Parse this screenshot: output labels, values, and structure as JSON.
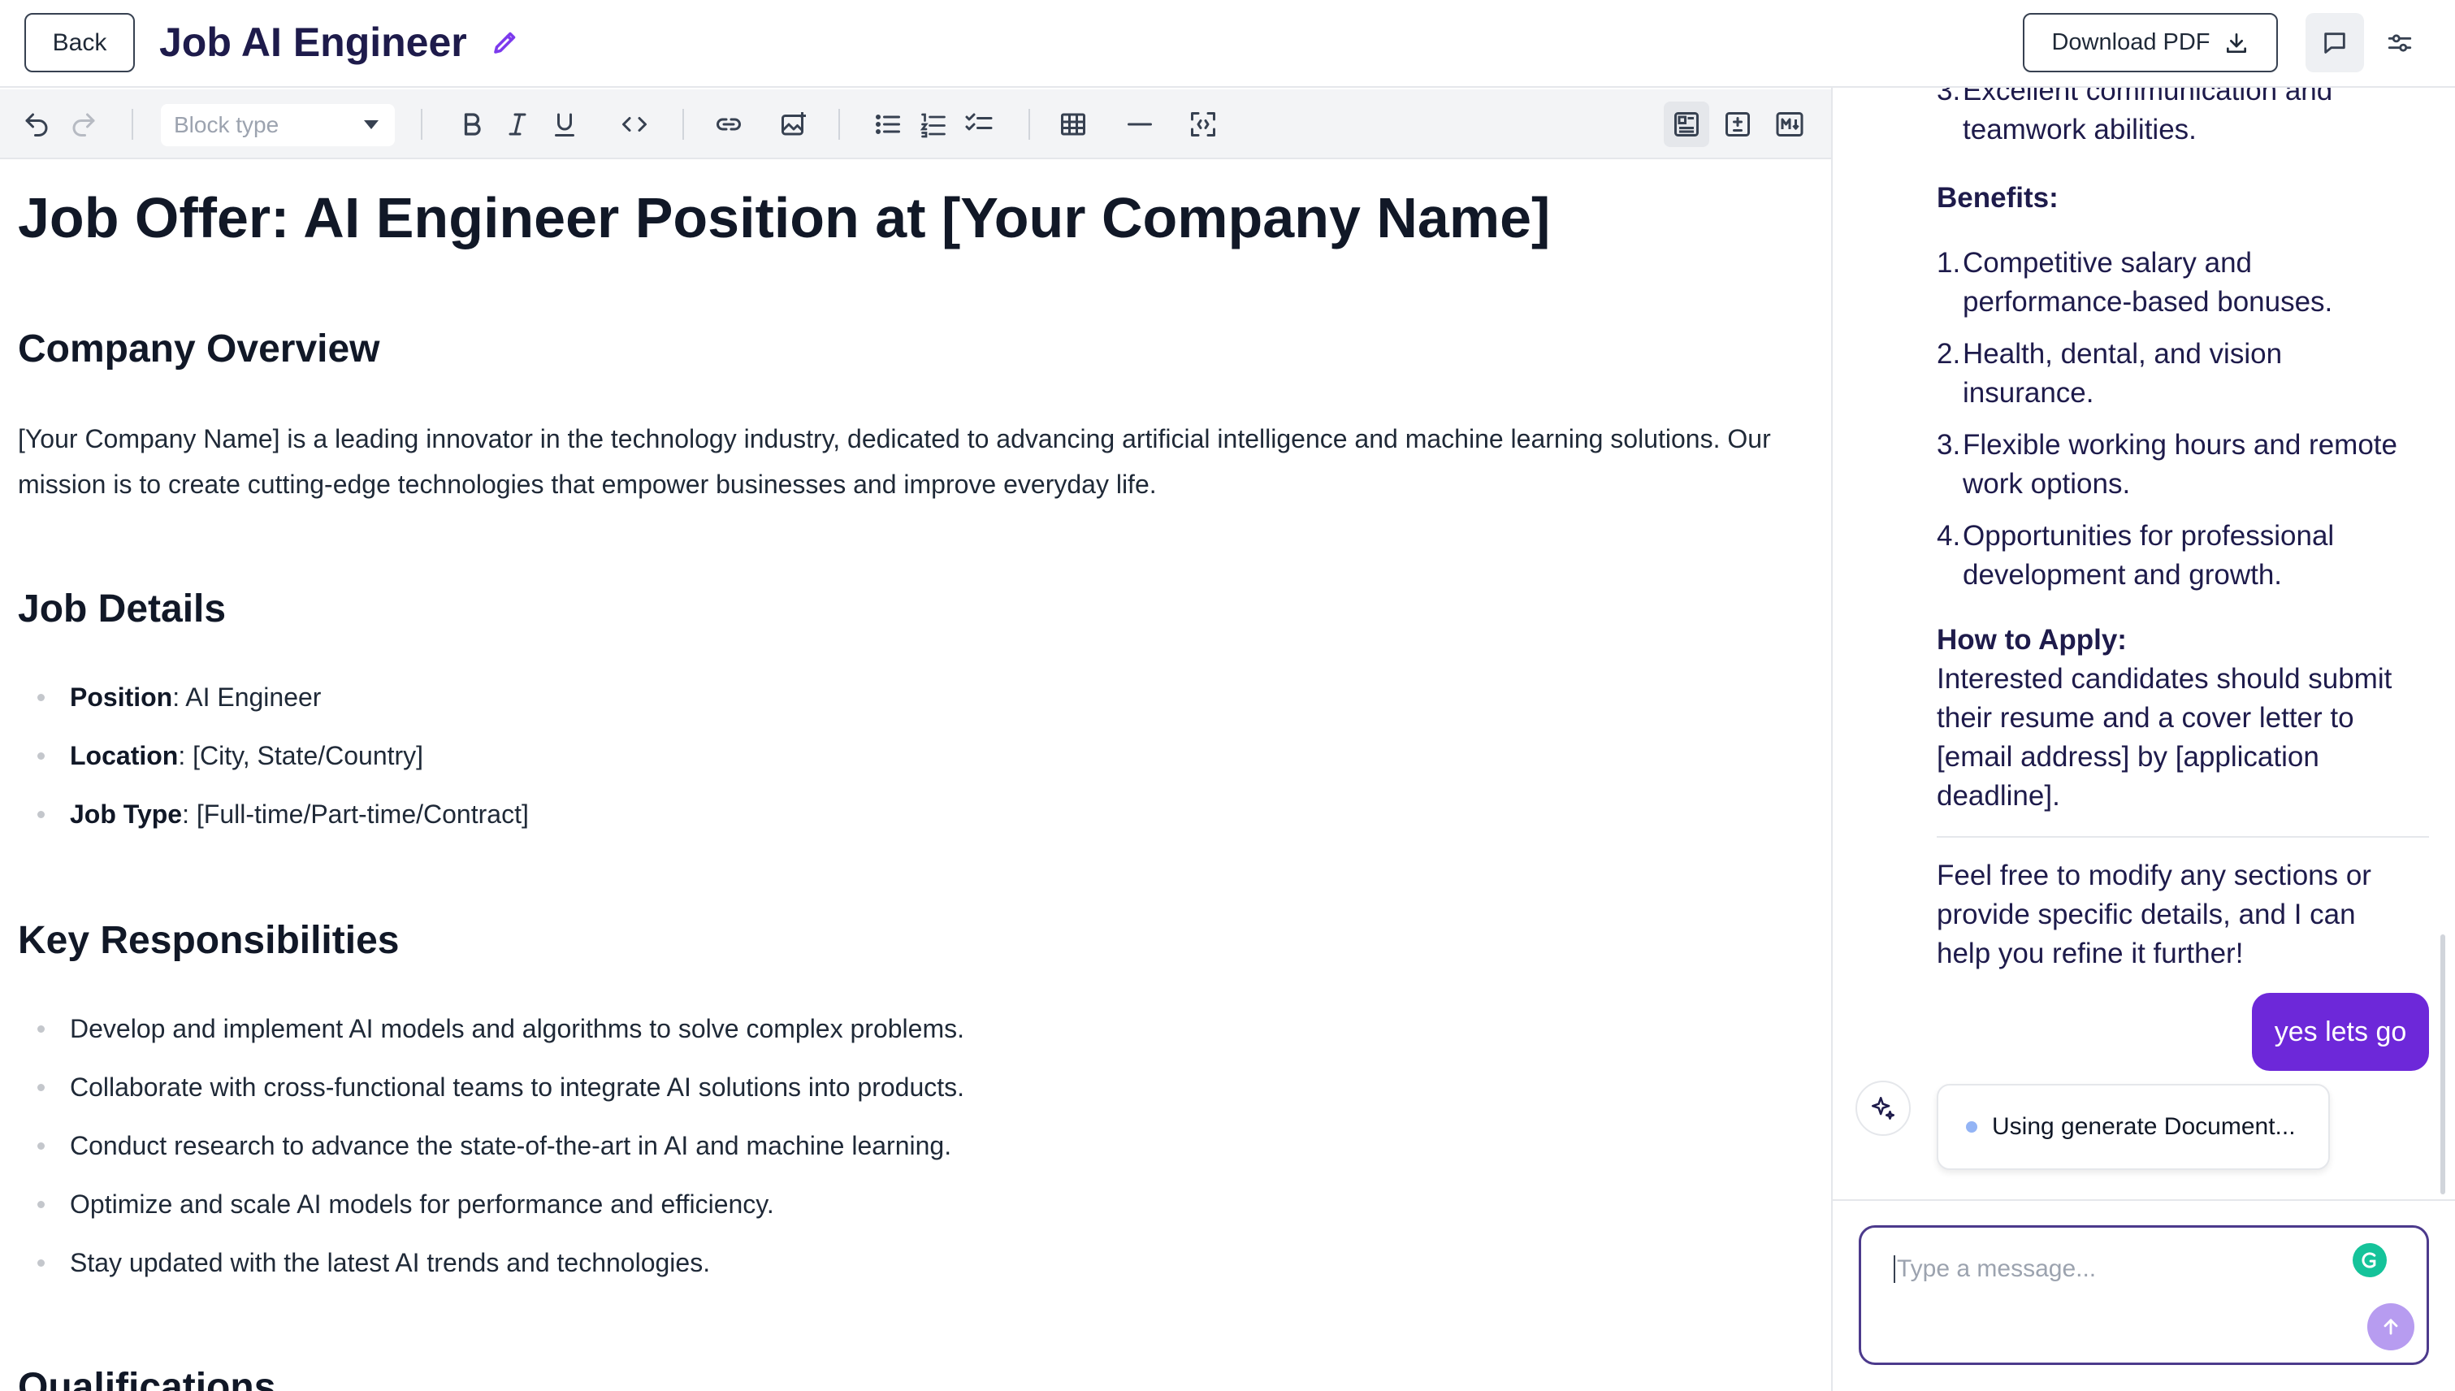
{
  "header": {
    "back_label": "Back",
    "title": "Job AI Engineer",
    "download_label": "Download PDF"
  },
  "toolbar": {
    "block_type_placeholder": "Block type",
    "icons": [
      "undo-icon",
      "redo-icon",
      "bold-icon",
      "italic-icon",
      "underline-icon",
      "code-icon",
      "link-icon",
      "image-icon",
      "bullet-list-icon",
      "numbered-list-icon",
      "checklist-icon",
      "table-icon",
      "horizontal-rule-icon",
      "fullscreen-icon",
      "rich-text-view-icon",
      "diff-view-icon",
      "markdown-view-icon"
    ]
  },
  "document": {
    "title": "Job Offer: AI Engineer Position at [Your Company Name]",
    "sections": [
      {
        "heading": "Company Overview",
        "paragraph_line1": "[Your Company Name] is a leading innovator in the technology industry, dedicated to advancing artificial intelligence and machine learning solutions. Our",
        "paragraph_line2": "mission is to create cutting-edge technologies that empower businesses and improve everyday life."
      },
      {
        "heading": "Job Details",
        "items": [
          {
            "label": "Position",
            "value": ": AI Engineer"
          },
          {
            "label": "Location",
            "value": ": [City, State/Country]"
          },
          {
            "label": "Job Type",
            "value": ": [Full-time/Part-time/Contract]"
          }
        ]
      },
      {
        "heading": "Key Responsibilities",
        "items": [
          "Develop and implement AI models and algorithms to solve complex problems.",
          "Collaborate with cross-functional teams to integrate AI solutions into products.",
          "Conduct research to advance the state-of-the-art in AI and machine learning.",
          "Optimize and scale AI models for performance and efficiency.",
          "Stay updated with the latest AI trends and technologies."
        ]
      },
      {
        "heading": "Qualifications"
      }
    ]
  },
  "chat": {
    "partial_item": {
      "num": "3.",
      "line1": "Excellent communication and",
      "line2": "teamwork abilities."
    },
    "benefits_heading": "Benefits:",
    "benefits": [
      {
        "num": "1.",
        "line1": "Competitive salary and",
        "line2": "performance-based bonuses."
      },
      {
        "num": "2.",
        "line1": "Health, dental, and vision",
        "line2": "insurance."
      },
      {
        "num": "3.",
        "line1": "Flexible working hours and remote",
        "line2": "work options."
      },
      {
        "num": "4.",
        "line1": "Opportunities for professional",
        "line2": "development and growth."
      }
    ],
    "apply_heading": "How to Apply:",
    "apply_lines": [
      "Interested candidates should submit",
      "their resume and a cover letter to",
      "[email address] by [application",
      "deadline]."
    ],
    "closing_lines": [
      "Feel free to modify any sections or",
      "provide specific details, and I can",
      "help you refine it further!"
    ],
    "user_message": "yes lets go",
    "tool_status": "Using generate Document...",
    "input_placeholder": "Type a message..."
  }
}
